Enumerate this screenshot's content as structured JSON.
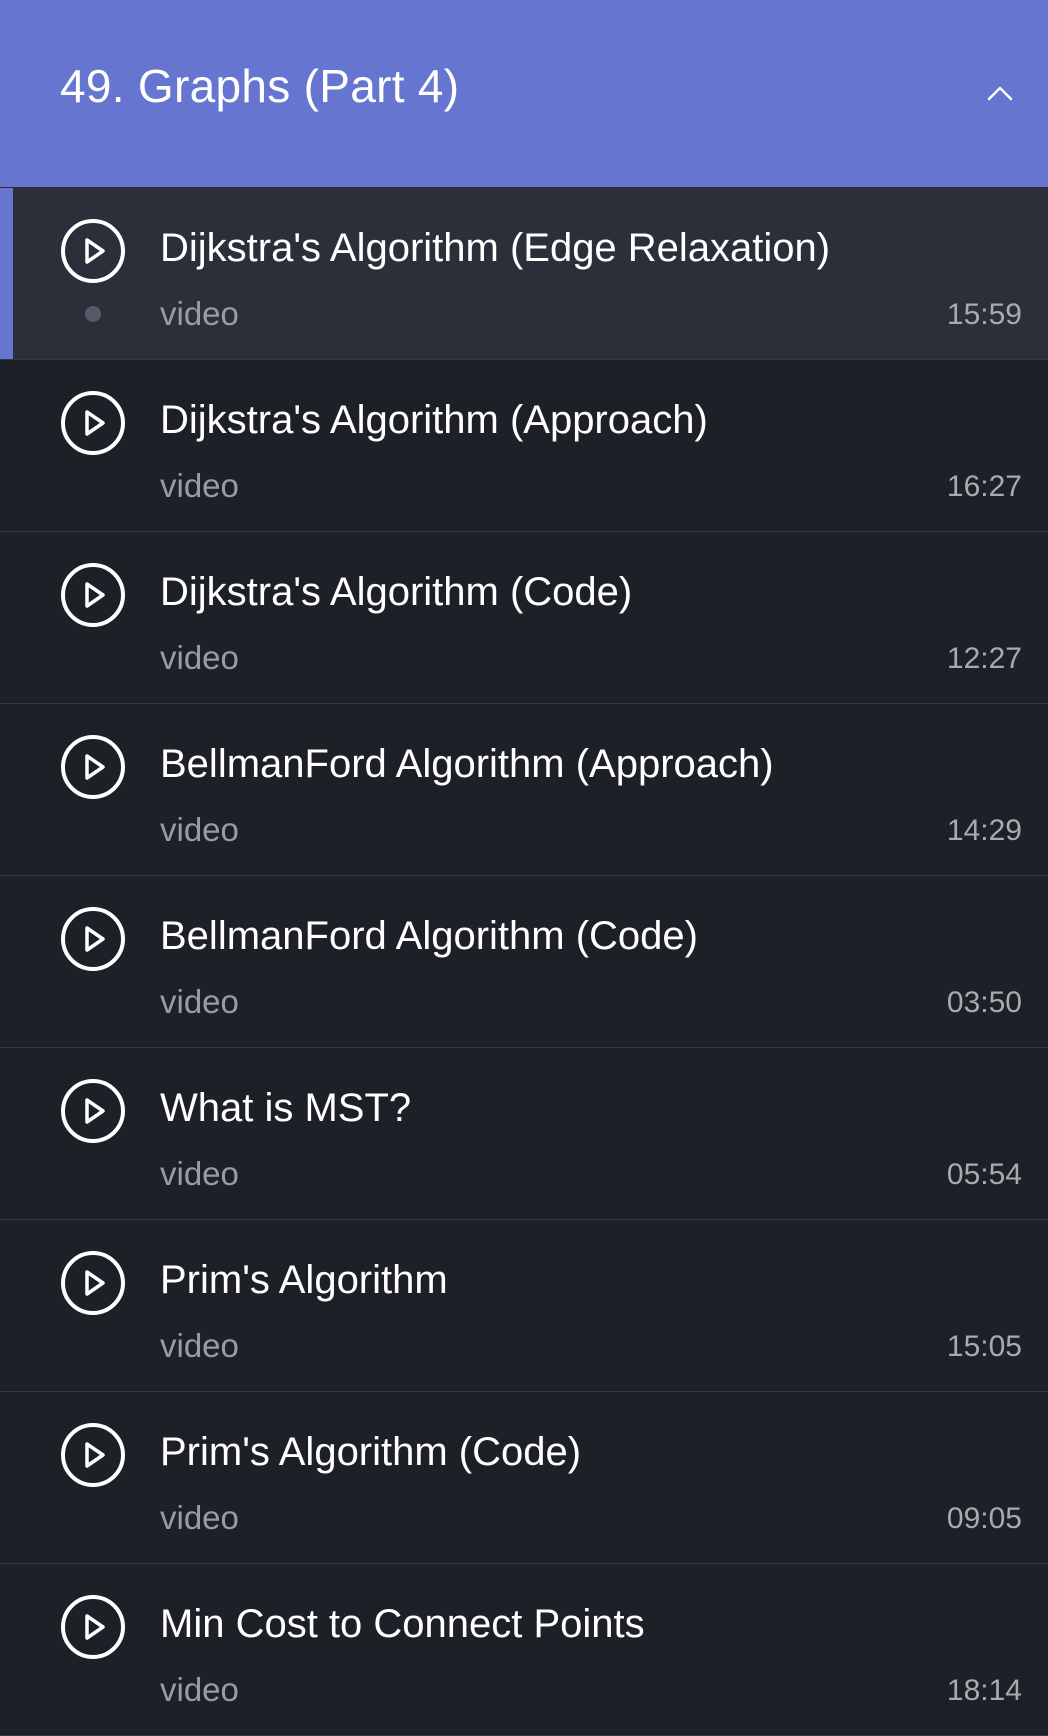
{
  "section": {
    "title": "49. Graphs (Part 4)",
    "collapse_icon": "chevron-up-icon"
  },
  "colors": {
    "header_bg": "#6675d0",
    "list_bg": "#1e2027",
    "active_bg": "#2b2f3a",
    "accent": "#6675d0"
  },
  "items": [
    {
      "title": "Dijkstra's Algorithm (Edge Relaxation)",
      "type": "video",
      "duration": "15:59",
      "active": true
    },
    {
      "title": "Dijkstra's Algorithm (Approach)",
      "type": "video",
      "duration": "16:27",
      "active": false
    },
    {
      "title": "Dijkstra's Algorithm (Code)",
      "type": "video",
      "duration": "12:27",
      "active": false
    },
    {
      "title": "BellmanFord Algorithm (Approach)",
      "type": "video",
      "duration": "14:29",
      "active": false
    },
    {
      "title": "BellmanFord Algorithm (Code)",
      "type": "video",
      "duration": "03:50",
      "active": false
    },
    {
      "title": "What is MST?",
      "type": "video",
      "duration": "05:54",
      "active": false
    },
    {
      "title": "Prim's Algorithm",
      "type": "video",
      "duration": "15:05",
      "active": false
    },
    {
      "title": "Prim's Algorithm (Code)",
      "type": "video",
      "duration": "09:05",
      "active": false
    },
    {
      "title": "Min Cost to Connect Points",
      "type": "video",
      "duration": "18:14",
      "active": false
    }
  ]
}
